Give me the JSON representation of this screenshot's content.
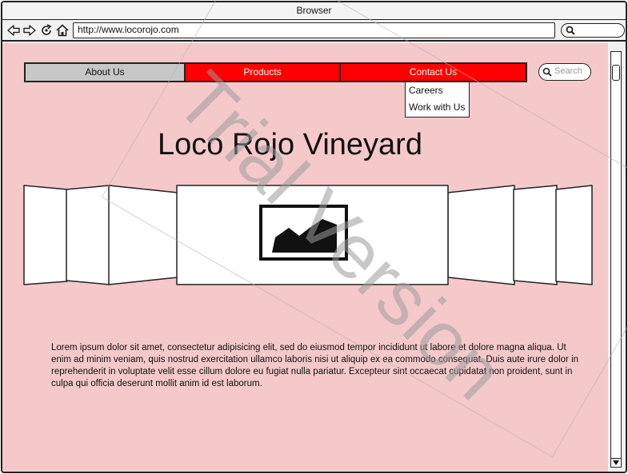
{
  "browser": {
    "title": "Browser",
    "url": "http://www.locorojo.com",
    "nav_icons": [
      "back-arrow-icon",
      "forward-arrow-icon",
      "reload-icon",
      "home-icon"
    ]
  },
  "menu": {
    "items": [
      {
        "label": "About Us",
        "state": "normal"
      },
      {
        "label": "Products",
        "state": "highlighted"
      },
      {
        "label": "Contact Us",
        "state": "highlighted"
      }
    ],
    "dropdown": [
      "Careers",
      "Work with Us"
    ]
  },
  "search": {
    "placeholder": "Search"
  },
  "page": {
    "title": "Loco Rojo Vineyard",
    "body": "Lorem ipsum dolor sit amet, consectetur adipisicing elit, sed do eiusmod tempor incididunt ut labore et dolore magna aliqua. Ut enim ad minim veniam, quis nostrud exercitation ullamco laboris nisi ut aliquip ex ea commodo consequat. Duis aute irure dolor in reprehenderit in voluptate velit esse cillum dolore eu fugiat nulla pariatur. Excepteur sint occaecat cupidatat non proident, sunt in culpa qui officia deserunt mollit anim id est laborum."
  },
  "watermark": "Trial Version",
  "colors": {
    "page_background": "#f5c9c9",
    "menu_active": "#ff0000",
    "menu_inactive": "#c7c7c7"
  }
}
